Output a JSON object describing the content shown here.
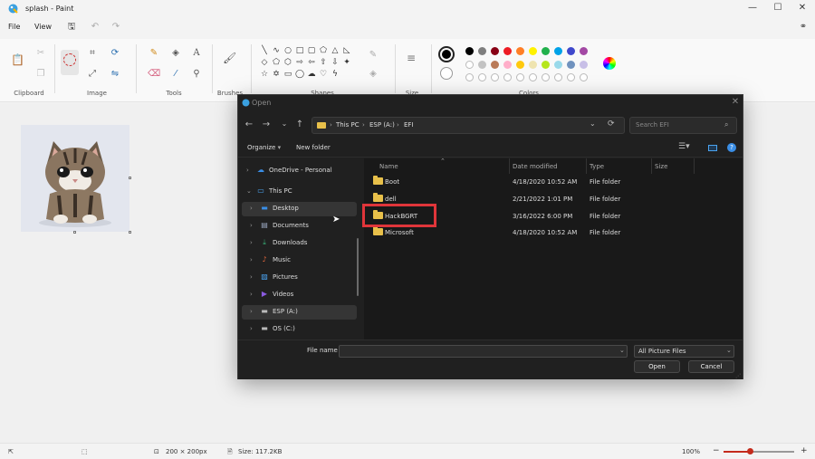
{
  "app": {
    "title": "splash - Paint",
    "menu": [
      "File",
      "View"
    ]
  },
  "ribbon": {
    "groups": [
      "Clipboard",
      "Image",
      "Tools",
      "Brushes",
      "Shapes",
      "Size",
      "Colors"
    ]
  },
  "colors": {
    "primary": "#000000",
    "secondary": "#ffffff",
    "palette_row1": [
      "#000000",
      "#7f7f7f",
      "#880015",
      "#ed1c24",
      "#ff7f27",
      "#fff200",
      "#22b14c",
      "#00a2e8",
      "#3f48cc",
      "#a349a4"
    ],
    "palette_row2": [
      "#ffffff",
      "#c3c3c3",
      "#b97a57",
      "#ffaec9",
      "#ffc90e",
      "#efe4b0",
      "#b5e61d",
      "#99d9ea",
      "#7092be",
      "#c8bfe7"
    ]
  },
  "status": {
    "image_size": "200 × 200px",
    "file_size": "Size: 117.2KB",
    "zoom": "100%"
  },
  "dialog": {
    "title": "Open",
    "breadcrumb": [
      "This PC",
      "ESP (A:)",
      "EFI"
    ],
    "search_placeholder": "Search EFI",
    "organize": "Organize",
    "new_folder": "New folder",
    "columns": [
      "Name",
      "Date modified",
      "Type",
      "Size"
    ],
    "nav_items": [
      {
        "label": "OneDrive - Personal",
        "icon": "cloud-icon",
        "color": "#3a8ee6"
      },
      {
        "label": "This PC",
        "icon": "computer-icon",
        "color": "#4aa3f0"
      },
      {
        "label": "Desktop",
        "icon": "desktop-icon",
        "color": "#3a8ee6"
      },
      {
        "label": "Documents",
        "icon": "documents-icon",
        "color": "#9aa7c0"
      },
      {
        "label": "Downloads",
        "icon": "download-icon",
        "color": "#39b37a"
      },
      {
        "label": "Music",
        "icon": "music-icon",
        "color": "#e0663c"
      },
      {
        "label": "Pictures",
        "icon": "pictures-icon",
        "color": "#4aa3f0"
      },
      {
        "label": "Videos",
        "icon": "videos-icon",
        "color": "#8a5be0"
      },
      {
        "label": "ESP (A:)",
        "icon": "drive-icon",
        "color": "#bbbbbb"
      },
      {
        "label": "OS (C:)",
        "icon": "drive-icon",
        "color": "#bbbbbb"
      }
    ],
    "files": [
      {
        "name": "Boot",
        "date": "4/18/2020 10:52 AM",
        "type": "File folder"
      },
      {
        "name": "dell",
        "date": "2/21/2022 1:01 PM",
        "type": "File folder"
      },
      {
        "name": "HackBGRT",
        "date": "3/16/2022 6:00 PM",
        "type": "File folder"
      },
      {
        "name": "Microsoft",
        "date": "4/18/2020 10:52 AM",
        "type": "File folder"
      }
    ],
    "file_name_label": "File name",
    "file_name_value": "",
    "file_type": "All Picture Files",
    "open_button": "Open",
    "cancel_button": "Cancel"
  }
}
